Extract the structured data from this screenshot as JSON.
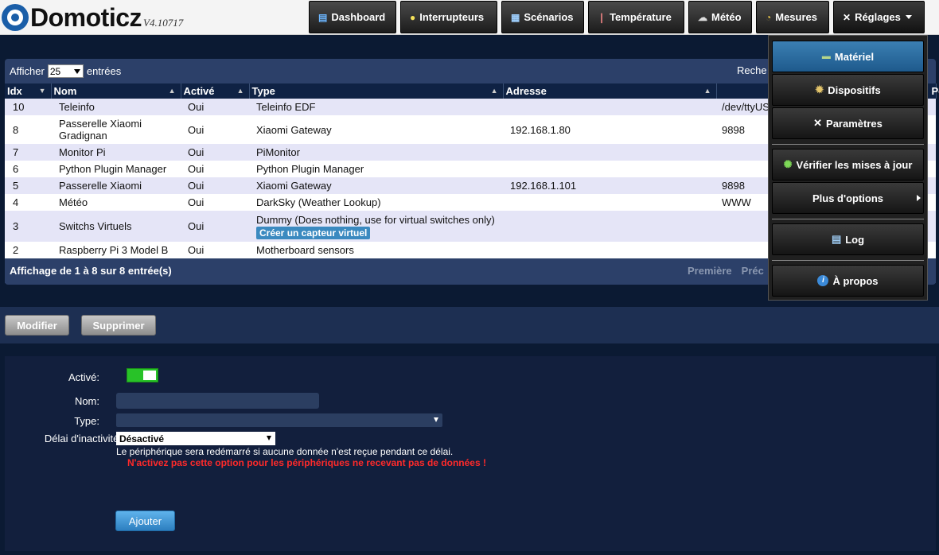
{
  "app": {
    "name": "Domoticz",
    "version": "V4.10717"
  },
  "nav": [
    {
      "label": "Dashboard",
      "icon": "monitor-icon"
    },
    {
      "label": "Interrupteurs",
      "icon": "lightbulb-icon"
    },
    {
      "label": "Scénarios",
      "icon": "clapperboard-icon"
    },
    {
      "label": "Température",
      "icon": "thermometer-icon"
    },
    {
      "label": "Météo",
      "icon": "cloud-icon"
    },
    {
      "label": "Mesures",
      "icon": "gauge-icon"
    },
    {
      "label": "Réglages",
      "icon": "tools-icon"
    }
  ],
  "table": {
    "show_prefix": "Afficher",
    "show_value": "25",
    "show_suffix": "entrées",
    "search_label": "Reche",
    "columns": [
      "Idx",
      "Nom",
      "Activé",
      "Type",
      "Adresse",
      "Port"
    ],
    "rows": [
      {
        "idx": "10",
        "nom": "Teleinfo",
        "active": "Oui",
        "type": "Teleinfo EDF",
        "adresse": "",
        "port": "/dev/ttyUS"
      },
      {
        "idx": "8",
        "nom": "Passerelle Xiaomi Gradignan",
        "active": "Oui",
        "type": "Xiaomi Gateway",
        "adresse": "192.168.1.80",
        "port": "9898"
      },
      {
        "idx": "7",
        "nom": "Monitor Pi",
        "active": "Oui",
        "type": "PiMonitor",
        "adresse": "",
        "port": ""
      },
      {
        "idx": "6",
        "nom": "Python Plugin Manager",
        "active": "Oui",
        "type": "Python Plugin Manager",
        "adresse": "",
        "port": ""
      },
      {
        "idx": "5",
        "nom": "Passerelle Xiaomi",
        "active": "Oui",
        "type": "Xiaomi Gateway",
        "adresse": "192.168.1.101",
        "port": "9898"
      },
      {
        "idx": "4",
        "nom": "Météo",
        "active": "Oui",
        "type": "DarkSky (Weather Lookup)",
        "adresse": "",
        "port": "WWW"
      },
      {
        "idx": "3",
        "nom": "Switchs Virtuels",
        "active": "Oui",
        "type": "Dummy (Does nothing, use for virtual switches only)",
        "type_button": "Créer un capteur virtuel",
        "adresse": "",
        "port": ""
      },
      {
        "idx": "2",
        "nom": "Raspberry Pi 3 Model B",
        "active": "Oui",
        "type": "Motherboard sensors",
        "adresse": "",
        "port": ""
      }
    ],
    "info": "Affichage de 1 à 8 sur 8 entrée(s)",
    "pager": {
      "first": "Première",
      "prev": "Préc"
    }
  },
  "actions": {
    "edit": "Modifier",
    "delete": "Supprimer"
  },
  "form": {
    "active_label": "Activé:",
    "name_label": "Nom:",
    "name_value": "",
    "type_label": "Type:",
    "type_value": "",
    "delay_label": "Délai d'inactivité:",
    "delay_value": "Désactivé",
    "delay_help": "Le périphérique sera redémarré si aucune donnée n'est reçue pendant ce délai.",
    "delay_warning": "N'activez pas cette option pour les périphériques ne recevant pas de données !",
    "add_label": "Ajouter"
  },
  "dropdown": {
    "items": [
      {
        "label": "Matériel",
        "icon": "hardware-icon"
      },
      {
        "label": "Dispositifs",
        "icon": "gear-icon"
      },
      {
        "label": "Paramètres",
        "icon": "tools-icon"
      },
      {
        "label": "Vérifier les mises à jour",
        "icon": "update-icon"
      },
      {
        "label": "Plus d'options",
        "icon": ""
      },
      {
        "label": "Log",
        "icon": "log-icon"
      },
      {
        "label": "À propos",
        "icon": "info-icon"
      }
    ]
  }
}
